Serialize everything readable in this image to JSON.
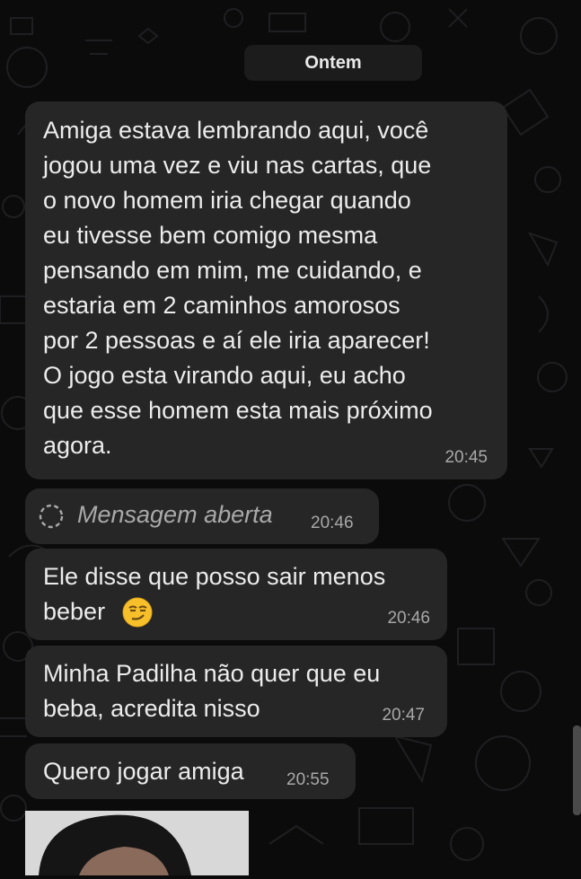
{
  "chat": {
    "date_divider": "Ontem",
    "messages": [
      {
        "text": "Amiga estava lembrando aqui, você\njogou uma vez e viu nas cartas, que\no novo homem iria chegar quando\neu tivesse bem comigo mesma\npensando em mim, me cuidando, e\nestaria em 2 caminhos amorosos\npor 2 pessoas e aí ele iria aparecer!\nO jogo esta virando aqui, eu acho\nque esse homem esta mais próximo\nagora.",
        "time": "20:45"
      },
      {
        "type": "view-once-opened",
        "text": "Mensagem aberta",
        "time": "20:46",
        "icon": "dashed-circle-icon"
      },
      {
        "text": "Ele disse que posso sair menos\nbeber",
        "emoji": "smirking-face-icon",
        "time": "20:46"
      },
      {
        "text": "Minha Padilha não quer que eu\nbeba, acredita nisso",
        "time": "20:47"
      },
      {
        "text": "Quero jogar amiga",
        "time": "20:55"
      }
    ]
  },
  "colors": {
    "background": "#0b0b0c",
    "bubble": "#262627",
    "text": "#ececec",
    "timestamp": "#a8a8a8"
  }
}
